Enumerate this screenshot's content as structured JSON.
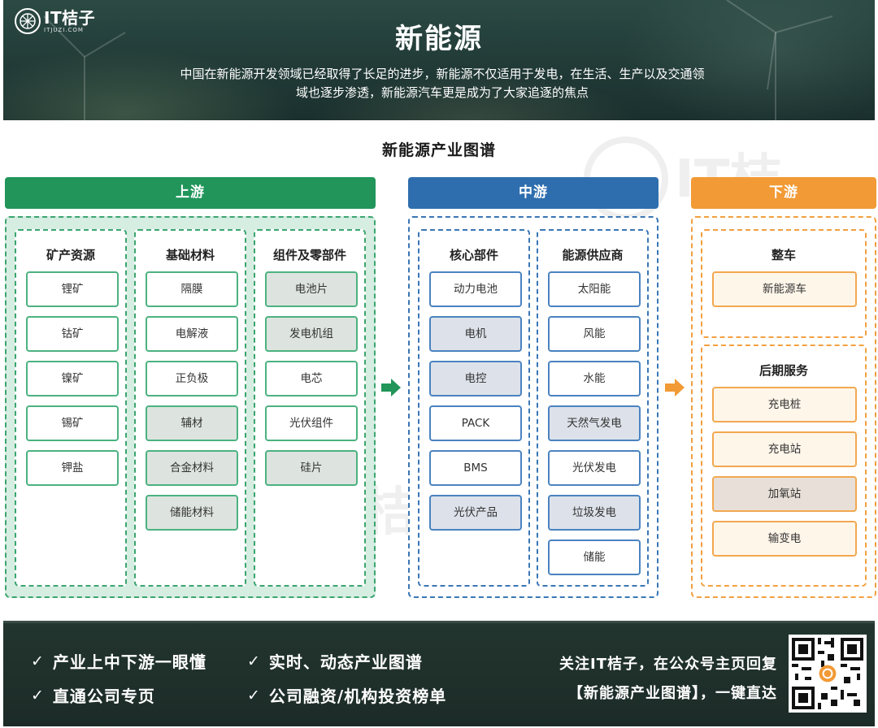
{
  "banner": {
    "logo_text": "IT桔子",
    "logo_sub": "ITJUZI.COM",
    "title": "新能源",
    "desc_line1": "中国在新能源开发领域已经取得了长足的进步，新能源不仅适用于发电，在生活、生产以及交通领",
    "desc_line2": "域也逐步渗透，新能源汽车更是成为了大家追逐的焦点"
  },
  "diagram_title": "新能源产业图谱",
  "stages": {
    "upstream": {
      "label": "上游",
      "color": "#21955a",
      "groups": [
        {
          "title": "矿产资源",
          "items": [
            "锂矿",
            "钴矿",
            "镍矿",
            "锡矿",
            "钾盐"
          ]
        },
        {
          "title": "基础材料",
          "items": [
            "隔膜",
            "电解液",
            "正负极",
            "辅材",
            "合金材料",
            "储能材料"
          ]
        },
        {
          "title": "组件及零部件",
          "items": [
            "电池片",
            "发电机组",
            "电芯",
            "光伏组件",
            "硅片"
          ]
        }
      ]
    },
    "midstream": {
      "label": "中游",
      "color": "#2f6eae",
      "groups": [
        {
          "title": "核心部件",
          "items": [
            "动力电池",
            "电机",
            "电控",
            "PACK",
            "BMS",
            "光伏产品"
          ]
        },
        {
          "title": "能源供应商",
          "items": [
            "太阳能",
            "风能",
            "水能",
            "天然气发电",
            "光伏发电",
            "垃圾发电",
            "储能"
          ]
        }
      ]
    },
    "downstream": {
      "label": "下游",
      "color": "#f29a35",
      "groups": [
        {
          "title": "整车",
          "items": [
            "新能源车"
          ]
        },
        {
          "title": "后期服务",
          "items": [
            "充电桩",
            "充电站",
            "加氧站",
            "输变电"
          ]
        }
      ]
    }
  },
  "footer": {
    "features": [
      "产业上中下游一眼懂",
      "实时、动态产业图谱",
      "直通公司专页",
      "公司融资/机构投资榜单"
    ],
    "check_glyph": "✓",
    "cta_line1": "关注IT桔子，在公众号主页回复",
    "cta_line2": "【新能源产业图谱】，一键直达"
  }
}
